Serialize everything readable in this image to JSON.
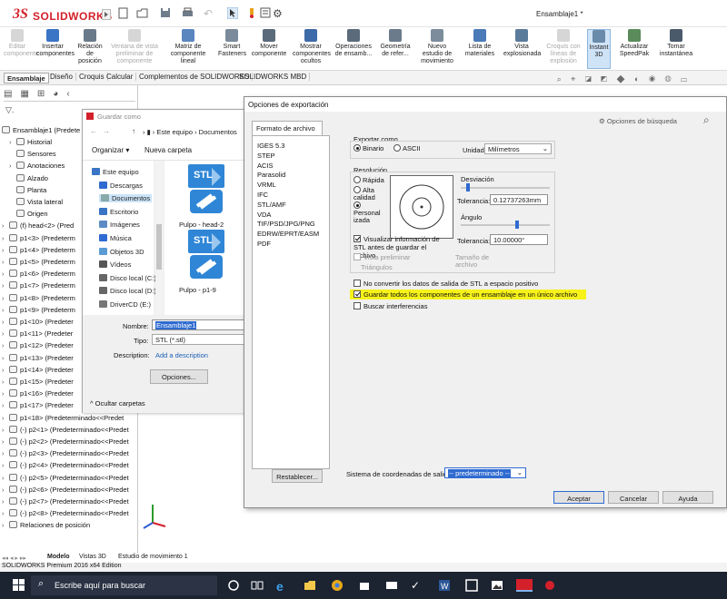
{
  "app": {
    "logo_ds": "3S",
    "logo_name": "SOLIDWORKS",
    "window_title": "Ensamblaje1 *",
    "status_text": "SOLIDWORKS Premium 2016 x64 Edition"
  },
  "ribbon": [
    {
      "label": "Editar componente",
      "disabled": true
    },
    {
      "label": "Insertar componentes",
      "disabled": false
    },
    {
      "label": "Relación de posición",
      "disabled": false
    },
    {
      "label": "Ventana de vista preliminar de componente",
      "disabled": true
    },
    {
      "label": "Matriz de componente lineal",
      "disabled": false
    },
    {
      "label": "Smart Fasteners",
      "disabled": false
    },
    {
      "label": "Mover componente",
      "disabled": false
    },
    {
      "label": "Mostrar componentes ocultos",
      "disabled": false
    },
    {
      "label": "Operaciones de ensamb...",
      "disabled": false
    },
    {
      "label": "Geometría de refer...",
      "disabled": false
    },
    {
      "label": "Nuevo estudio de movimiento",
      "disabled": false
    },
    {
      "label": "Lista de materiales",
      "disabled": false
    },
    {
      "label": "Vista explosionada",
      "disabled": false
    },
    {
      "label": "Croquis con líneas de explosión",
      "disabled": true
    },
    {
      "label": "Instant 3D",
      "disabled": false,
      "active": true
    },
    {
      "label": "Actualizar SpeedPak",
      "disabled": false
    },
    {
      "label": "Tomar instantánea",
      "disabled": false
    }
  ],
  "command_tabs": [
    "Ensamblaje",
    "Diseño",
    "Croquis",
    "Calcular",
    "Complementos de SOLIDWORKS",
    "SOLIDWORKS MBD"
  ],
  "tree": {
    "root": "Ensamblaje1 (Predete",
    "items": [
      "Historial",
      "Sensores",
      "Anotaciones",
      "Alzado",
      "Planta",
      "Vista lateral",
      "Origen",
      "(f) head<2> (Pred",
      "p1<3> (Predeterm",
      "p1<4> (Predeterm",
      "p1<5> (Predeterm",
      "p1<6> (Predeterm",
      "p1<7> (Predeterm",
      "p1<8> (Predeterm",
      "p1<9> (Predeterm",
      "p1<10> (Predeter",
      "p1<11> (Predeter",
      "p1<12> (Predeter",
      "p1<13> (Predeter",
      "p1<14> (Predeter",
      "p1<15> (Predeter",
      "p1<16> (Predeter",
      "p1<17> (Predeter",
      "p1<18> (Predeterminado<<Predet",
      "(-) p2<1> (Predeterminado<<Predet",
      "(-) p2<2> (Predeterminado<<Predet",
      "(-) p2<3> (Predeterminado<<Predet",
      "(-) p2<4> (Predeterminado<<Predet",
      "(-) p2<5> (Predeterminado<<Predet",
      "(-) p2<6> (Predeterminado<<Predet",
      "(-) p2<7> (Predeterminado<<Predet",
      "(-) p2<8> (Predeterminado<<Predet",
      "Relaciones de posición"
    ]
  },
  "bottom_tabs": [
    "Modelo",
    "Vistas 3D",
    "Estudio de movimiento 1"
  ],
  "save_dialog": {
    "title": "Guardar como",
    "breadcrumb": [
      "Este equipo",
      "Documentos"
    ],
    "organize": "Organizar",
    "new_folder": "Nueva carpeta",
    "nav": [
      "Este equipo",
      "Descargas",
      "Documentos",
      "Escritorio",
      "Imágenes",
      "Música",
      "Objetos 3D",
      "Vídeos",
      "Disco local (C:)",
      "Disco local (D:)",
      "DriverCD (E:)"
    ],
    "files": [
      {
        "name": "Pulpo - head-2",
        "badge": "STL"
      },
      {
        "name": "Pulpo - p1-9",
        "badge": "STL"
      }
    ],
    "name_label": "Nombre:",
    "name_value": "Ensamblaje1",
    "type_label": "Tipo:",
    "type_value": "STL (*.stl)",
    "desc_label": "Description:",
    "desc_link": "Add a description",
    "options_button": "Opciones...",
    "hide_folders": "Ocultar carpetas"
  },
  "export_dialog": {
    "title": "Opciones de exportación",
    "tab": "Formato de archivo",
    "search": "Opciones de búsqueda",
    "formats": [
      "IGES 5.3",
      "STEP",
      "ACIS",
      "Parasolid",
      "VRML",
      "IFC",
      "STL/AMF",
      "VDA",
      "TIF/PSD/JPG/PNG",
      "EDRW/EPRT/EASM",
      "PDF"
    ],
    "export_as": "Exportar como",
    "binary": "Binario",
    "ascii": "ASCII",
    "unit_label": "Unidad:",
    "unit_value": "Milímetros",
    "resolution": "Resolución",
    "res_options": [
      "Rápida",
      "Alta calidad",
      "Personal izada"
    ],
    "deviation": "Desviación",
    "tolerance_label": "Tolerancia:",
    "deviation_value": "0.12737263mm",
    "angle": "Ángulo",
    "angle_value": "10.00000°",
    "show_info": "Visualizar información de STL antes de guardar el archivo",
    "preview": "Vista preliminar",
    "triangles": "Triángulos",
    "file_size": "Tamaño de archivo",
    "no_convert": "No convertir los datos de salida de STL a espacio positivo",
    "save_all": "Guardar todos los componentes de un ensamblaje en un único archivo",
    "check_interf": "Buscar interferencias",
    "coord_label": "Sistema de coordenadas de salida:",
    "coord_value": "-- predeterminado --",
    "reset": "Restablecer...",
    "ok": "Aceptar",
    "cancel": "Cancelar",
    "help": "Ayuda",
    "checked": {
      "binary": true,
      "custom": true,
      "show_info": true,
      "save_all": true
    }
  },
  "taskbar": {
    "search_placeholder": "Escribe aquí para buscar"
  },
  "colors": {
    "sw_red": "#d3202a",
    "highlight": "#f7f21a",
    "taskbar": "#1c2331",
    "stl_blue": "#2f86d6"
  }
}
